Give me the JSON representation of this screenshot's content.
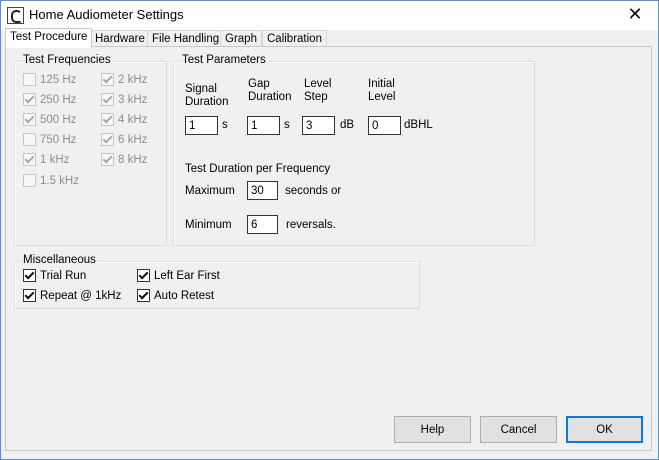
{
  "window": {
    "title": "Home Audiometer Settings",
    "close_glyph": "✕"
  },
  "tabs": [
    {
      "label": "Test Procedure",
      "active": true
    },
    {
      "label": "Hardware"
    },
    {
      "label": "File Handling"
    },
    {
      "label": "Graph"
    },
    {
      "label": "Calibration"
    }
  ],
  "test_frequencies": {
    "label": "Test Frequencies",
    "items": [
      {
        "label": "125 Hz",
        "checked": false
      },
      {
        "label": "250 Hz",
        "checked": true
      },
      {
        "label": "500 Hz",
        "checked": true
      },
      {
        "label": "750 Hz",
        "checked": false
      },
      {
        "label": "1 kHz",
        "checked": true
      },
      {
        "label": "1.5 kHz",
        "checked": false
      },
      {
        "label": "2 kHz",
        "checked": true
      },
      {
        "label": "3 kHz",
        "checked": true
      },
      {
        "label": "4 kHz",
        "checked": true
      },
      {
        "label": "6 kHz",
        "checked": true
      },
      {
        "label": "8 kHz",
        "checked": true
      }
    ]
  },
  "test_parameters": {
    "label": "Test Parameters",
    "signal_duration": {
      "header": "Signal\nDuration",
      "value": "1",
      "unit": "s"
    },
    "gap_duration": {
      "header": "Gap\nDuration",
      "value": "1",
      "unit": "s"
    },
    "level_step": {
      "header": "Level\nStep",
      "value": "3",
      "unit": "dB"
    },
    "initial_level": {
      "header": "Initial\nLevel",
      "value": "0",
      "unit": "dBHL"
    },
    "duration_label": "Test Duration per Frequency",
    "maximum": {
      "label": "Maximum",
      "value": "30",
      "unit": "seconds or"
    },
    "minimum": {
      "label": "Minimum",
      "value": "6",
      "unit": "reversals."
    }
  },
  "miscellaneous": {
    "label": "Miscellaneous",
    "items": [
      {
        "label": "Trial Run",
        "checked": true
      },
      {
        "label": "Repeat @ 1kHz",
        "checked": true
      },
      {
        "label": "Left Ear First",
        "checked": true
      },
      {
        "label": "Auto Retest",
        "checked": true
      }
    ]
  },
  "buttons": {
    "help": "Help",
    "cancel": "Cancel",
    "ok": "OK"
  },
  "colors": {
    "accent": "#0a78d7",
    "dialog_bg": "#f0f0f0",
    "disabled_text": "#8d8d8d"
  }
}
